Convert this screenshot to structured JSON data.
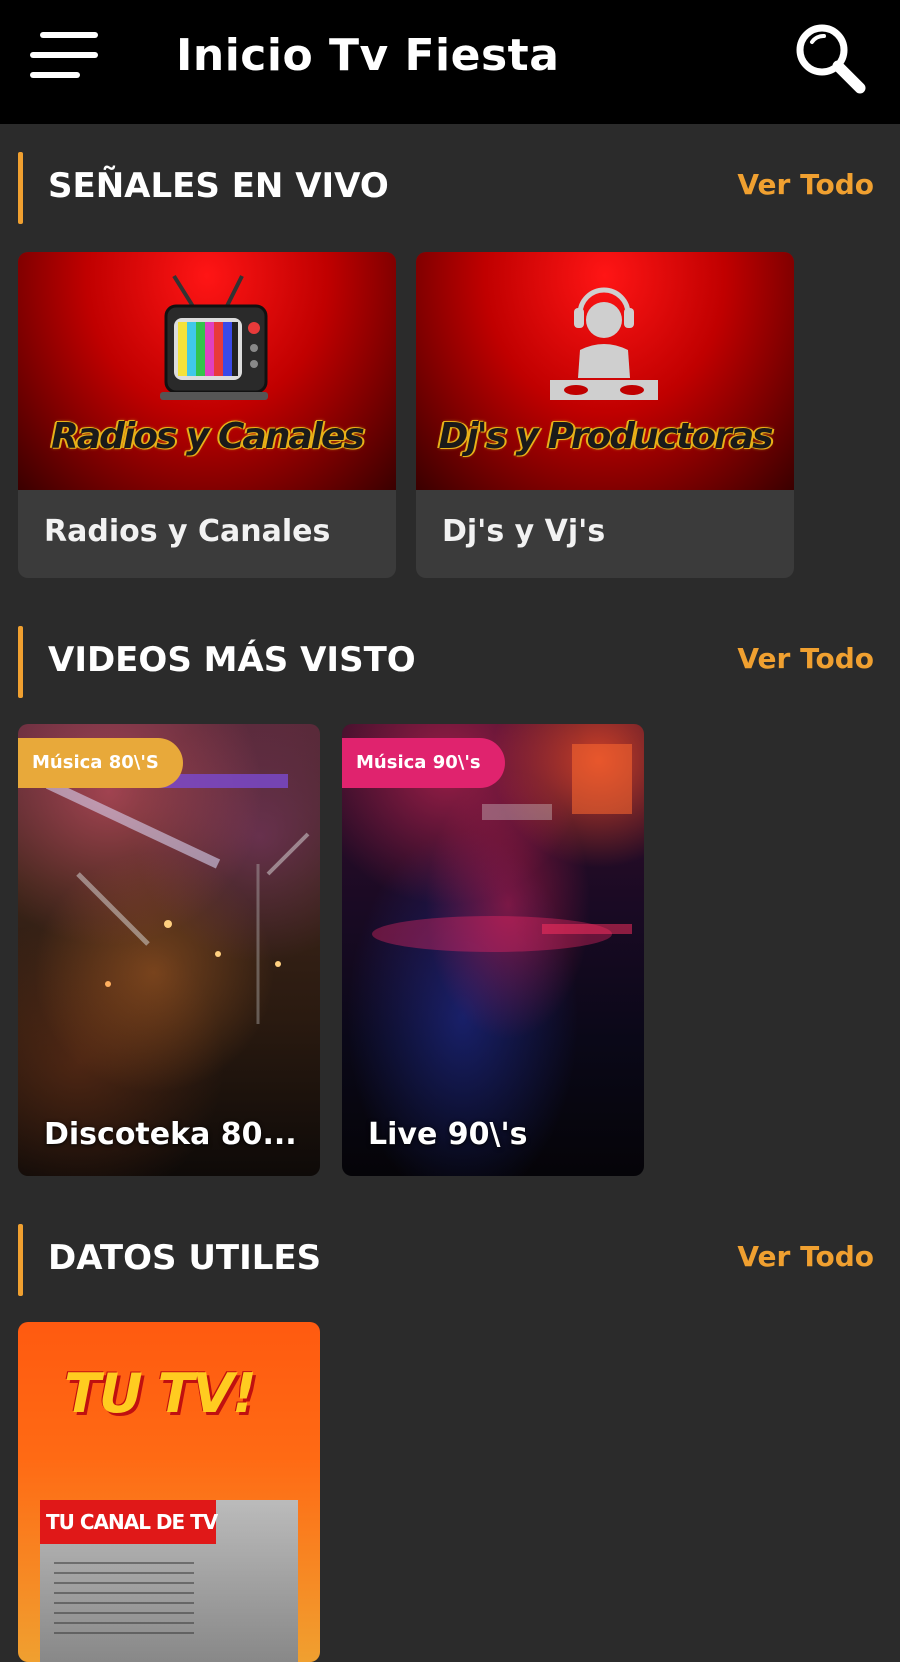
{
  "appbar": {
    "title": "Inicio Tv Fiesta",
    "menu_icon": "hamburger-menu-icon",
    "search_icon": "search-icon"
  },
  "colors": {
    "accent": "#f0a030",
    "badge_80s": "#e8a93a",
    "badge_90s": "#e0236e",
    "background": "#2b2b2b",
    "appbar": "#000000"
  },
  "sections": [
    {
      "title": "SEÑALES EN VIVO",
      "see_all": "Ver Todo",
      "cards": [
        {
          "thumb_text": "Radios y Canales",
          "caption": "Radios y Canales",
          "icon": "retro-tv-icon"
        },
        {
          "thumb_text": "Dj's y Productoras",
          "caption": "Dj's y Vj's",
          "icon": "dj-headphones-icon"
        }
      ]
    },
    {
      "title": "VIDEOS MÁS VISTO",
      "see_all": "Ver Todo",
      "videos": [
        {
          "badge": "Música 80\\'S",
          "caption": "Discoteka 80..."
        },
        {
          "badge": "Música 90\\'s",
          "caption": "Live 90\\'s"
        }
      ]
    },
    {
      "title": "DATOS UTILES",
      "see_all": "Ver Todo",
      "cards": [
        {
          "logo_text": "TU TV!",
          "banner_text": "TU CANAL DE TV"
        }
      ]
    }
  ]
}
